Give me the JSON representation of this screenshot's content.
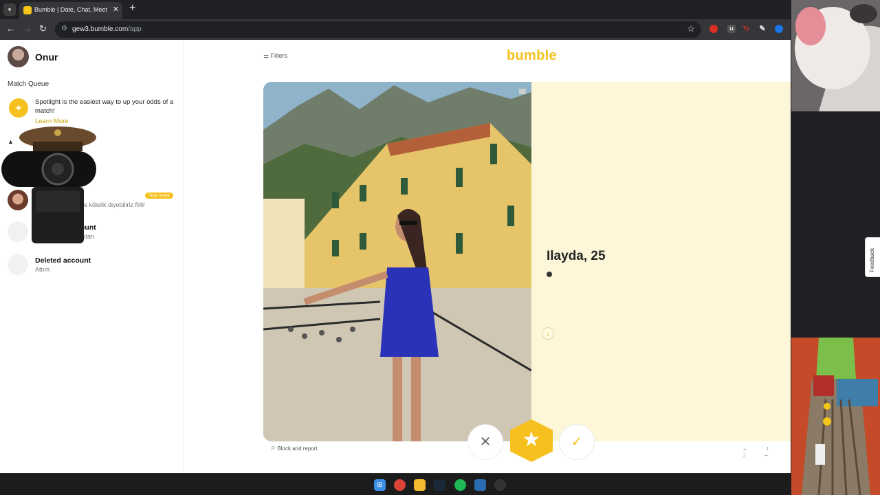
{
  "browser": {
    "tab_title": "Bumble | Date, Chat, Meet New",
    "tab_close": "✕",
    "new_tab": "+",
    "url_host": "gew3.bumble.com",
    "url_path": "/app",
    "ext_badge": "11",
    "ext_tp": "Tp"
  },
  "user": {
    "name": "Onur"
  },
  "sidebar": {
    "match_queue_title": "Match Queue",
    "spotlight_text": "Spotlight is the easiest way to up your odds of a match!",
    "learn_more": "Learn More",
    "chats": [
      {
        "name": "",
        "message": "de kölelik diyebiliriz flrllr",
        "badge": "Your move"
      },
      {
        "name": "ount",
        "message": "adan"
      },
      {
        "name": "Deleted account",
        "message": "Attım"
      }
    ]
  },
  "header": {
    "filters_label": "Filters",
    "logo": "bumble"
  },
  "profile": {
    "name_age": "Ilayda, 25"
  },
  "actions": {
    "pass_icon": "✕",
    "superswipe_icon": "★",
    "like_icon": "✓"
  },
  "footer": {
    "block_report": "Block and report",
    "keys": "← ↑ ↓ →"
  },
  "feedback_label": "Feedback",
  "colors": {
    "brand": "#f6c11f",
    "card_bg": "#fdf6d8"
  },
  "icons": [
    "menu-icon",
    "search-icon",
    "star-icon",
    "filters-icon",
    "close-icon",
    "check-icon",
    "flag-icon"
  ]
}
